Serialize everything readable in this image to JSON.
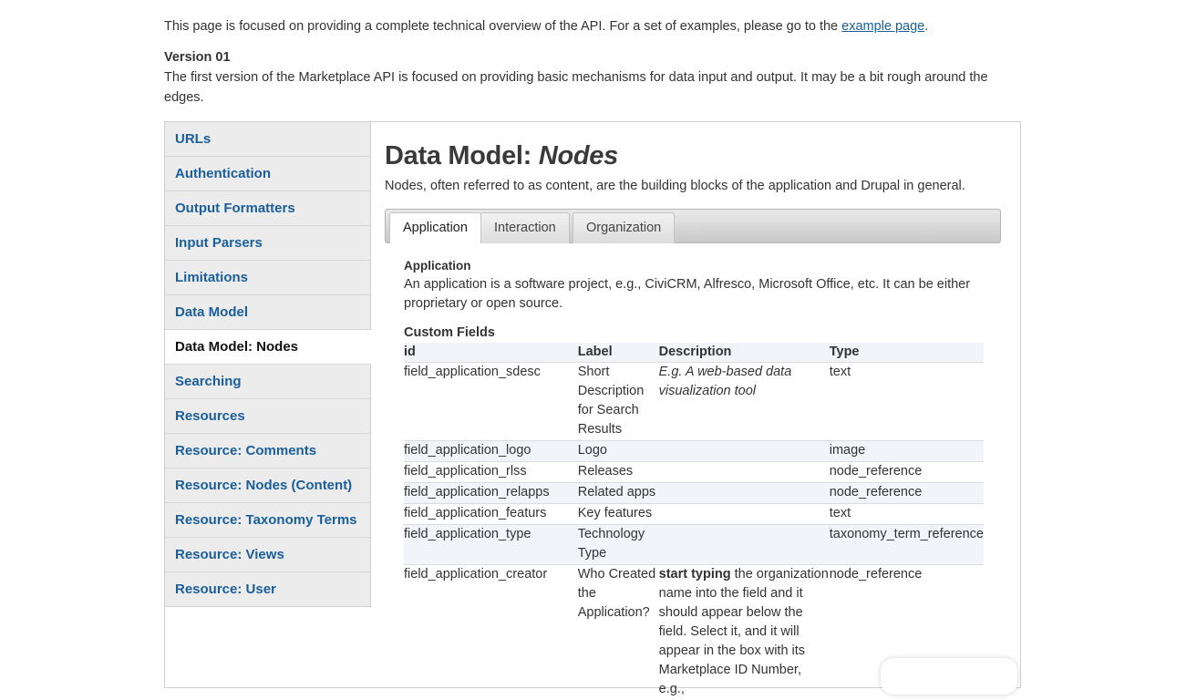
{
  "intro": {
    "text_before_link": "This page is focused on providing a complete technical overview of the API. For a set of examples, please go to the ",
    "link_text": "example page",
    "text_after_link": ".",
    "version_title": "Version 01",
    "version_text": "The first version of the Marketplace API is focused on providing basic mechanisms for data input and output. It may be a bit rough around the edges."
  },
  "sidebar": {
    "items": [
      {
        "label": "URLs"
      },
      {
        "label": "Authentication"
      },
      {
        "label": "Output Formatters"
      },
      {
        "label": "Input Parsers"
      },
      {
        "label": "Limitations"
      },
      {
        "label": "Data Model"
      },
      {
        "label": "Data Model: Nodes",
        "active": true
      },
      {
        "label": "Searching"
      },
      {
        "label": "Resources"
      },
      {
        "label": "Resource: Comments"
      },
      {
        "label": "Resource: Nodes (Content)"
      },
      {
        "label": "Resource: Taxonomy Terms"
      },
      {
        "label": "Resource: Views"
      },
      {
        "label": "Resource: User"
      }
    ]
  },
  "main": {
    "title_prefix": "Data Model: ",
    "title_emphasis": "Nodes",
    "lead": "Nodes, often referred to as content, are the building blocks of the application and Drupal in general.",
    "tabs": [
      {
        "label": "Application",
        "active": true
      },
      {
        "label": "Interaction"
      },
      {
        "label": "Organization"
      }
    ],
    "section_title": "Application",
    "section_text": "An application is a software project, e.g., CiviCRM, Alfresco, Microsoft Office, etc. It can be either proprietary or open source.",
    "fields_title": "Custom Fields",
    "table": {
      "headers": [
        "id",
        "Label",
        "Description",
        "Type"
      ],
      "rows": [
        {
          "id": "field_application_sdesc",
          "label": "Short Description for Search Results",
          "desc": "E.g. A web-based data visualization tool",
          "type": "text"
        },
        {
          "id": "field_application_logo",
          "label": "Logo",
          "desc": "",
          "type": "image"
        },
        {
          "id": "field_application_rlss",
          "label": "Releases",
          "desc": "",
          "type": "node_reference"
        },
        {
          "id": "field_application_relapps",
          "label": "Related apps",
          "desc": "",
          "type": "node_reference"
        },
        {
          "id": "field_application_featurs",
          "label": "Key features",
          "desc": "",
          "type": "text"
        },
        {
          "id": "field_application_type",
          "label": "Technology Type",
          "desc": "",
          "type": "taxonomy_term_reference"
        },
        {
          "id": "field_application_creator",
          "label": "Who Created the Application?",
          "desc_strong": "start typing",
          "desc": " the organization name into the field and it should appear below the field. Select it, and it will appear in the box with its Marketplace ID Number, e.g.,",
          "type": "node_reference"
        }
      ]
    }
  },
  "colors": {
    "link": "#1a5e9c",
    "sidebar_bg": "#ececec",
    "row_alt_bg": "#f1f4f8"
  }
}
